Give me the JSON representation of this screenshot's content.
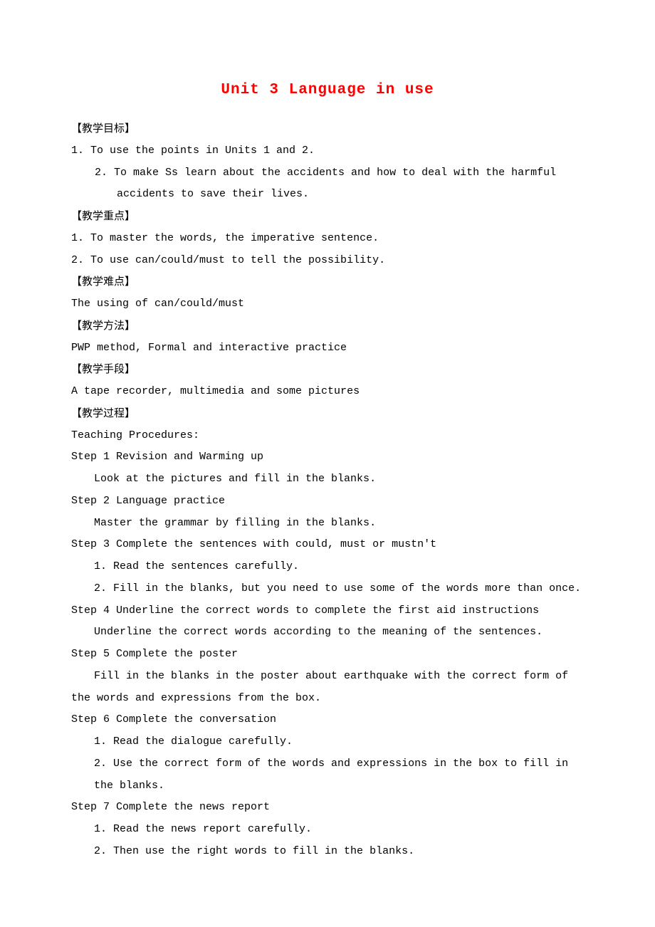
{
  "title": "Unit 3 Language in use",
  "sections": {
    "objectives": {
      "head": "【教学目标】",
      "items": [
        "1. To use the points in Units 1 and 2.",
        "2. To make Ss learn about the accidents and how to deal with the harmful accidents to save their lives."
      ]
    },
    "focus": {
      "head": "【教学重点】",
      "items": [
        "1. To master the words, the imperative sentence.",
        "2. To use can/could/must to tell the possibility."
      ]
    },
    "difficulty": {
      "head": "【教学难点】",
      "body": "The using of can/could/must"
    },
    "method": {
      "head": "【教学方法】",
      "body": "PWP method, Formal and interactive practice"
    },
    "means": {
      "head": "【教学手段】",
      "body": "A tape recorder, multimedia and some pictures"
    },
    "process": {
      "head": "【教学过程】",
      "intro": "Teaching Procedures:",
      "steps": [
        {
          "title": "Step 1 Revision and Warming up",
          "lines": [
            "Look at the pictures and fill in the blanks."
          ]
        },
        {
          "title": "Step 2 Language practice",
          "lines": [
            "Master the grammar by filling in the blanks."
          ]
        },
        {
          "title": "Step 3 Complete the sentences with could, must or mustn't",
          "nums": [
            "1. Read the sentences carefully.",
            "2. Fill in the blanks, but you need to use some of the words more than once."
          ]
        },
        {
          "title": "Step 4 Underline the correct words to complete the first aid instructions",
          "lines": [
            "Underline the correct words according to the meaning of the sentences."
          ]
        },
        {
          "title": "Step 5 Complete the poster",
          "wraplines": [
            "Fill in the blanks in the poster about earthquake with the correct form of the words and expressions from the box."
          ]
        },
        {
          "title": "Step 6 Complete the conversation",
          "nums": [
            "1. Read the dialogue carefully.",
            "2. Use the correct form of the words and expressions in the box to fill in the blanks."
          ]
        },
        {
          "title": "Step 7 Complete the news report",
          "nums": [
            "1. Read the news report carefully.",
            "2. Then use the right words to fill in the blanks."
          ]
        }
      ]
    }
  }
}
